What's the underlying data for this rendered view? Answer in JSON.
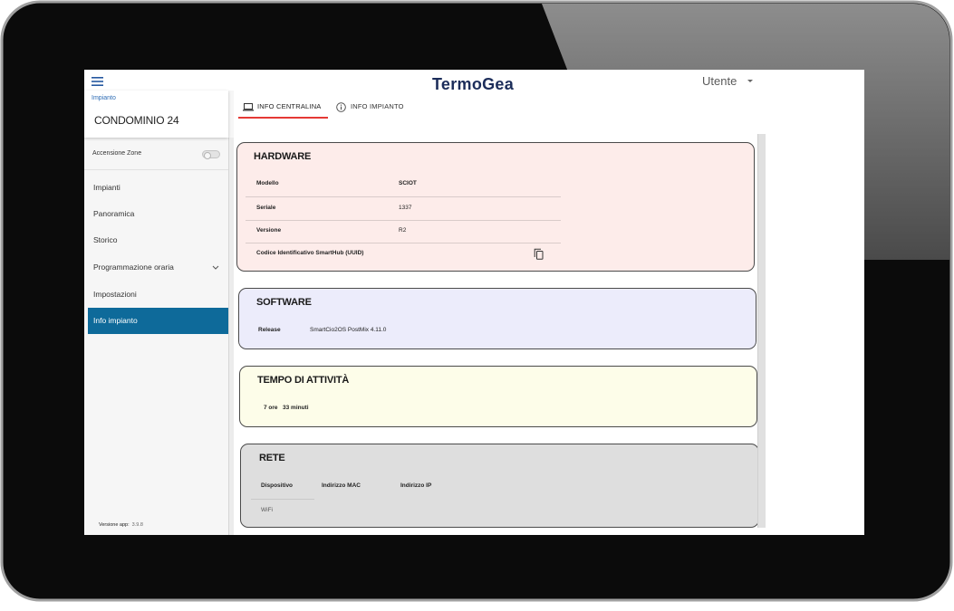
{
  "header": {
    "logo": "TermoGea",
    "user": "Utente"
  },
  "sidebar": {
    "plant_label": "Impianto",
    "plant_name": "CONDOMINIO 24",
    "zones_toggle": {
      "label": "Accensione Zone",
      "on": false
    },
    "items": [
      {
        "label": "Impianti",
        "selected": false
      },
      {
        "label": "Panoramica",
        "selected": false
      },
      {
        "label": "Storico",
        "selected": false
      },
      {
        "label": "Programmazione oraria",
        "selected": false,
        "expandable": true
      },
      {
        "label": "Impostazioni",
        "selected": false
      },
      {
        "label": "Info impianto",
        "selected": true
      }
    ],
    "app_version_label": "Versione app:",
    "app_version": "3.9.8"
  },
  "tabs": [
    {
      "label": "INFO CENTRALINA",
      "icon": "laptop-icon",
      "active": true
    },
    {
      "label": "INFO IMPIANTO",
      "icon": "info-icon",
      "active": false
    }
  ],
  "hardware": {
    "title": "HARDWARE",
    "rows": [
      {
        "label": "Modello",
        "value": "SCIOT"
      },
      {
        "label": "Seriale",
        "value": "1337"
      },
      {
        "label": "Versione",
        "value": "R2"
      },
      {
        "label": "Codice Identificativo SmartHub (UUID)",
        "action_icon": "copy-icon"
      }
    ]
  },
  "software": {
    "title": "SOFTWARE",
    "release_label": "Release",
    "release_value": "SmartCio2OS PostMix 4.11.0"
  },
  "uptime": {
    "title": "TEMPO DI ATTIVITÀ",
    "hours": "7 ore",
    "minutes": "33 minuti"
  },
  "network": {
    "title": "RETE",
    "columns": [
      "Dispositivo",
      "Indirizzo MAC",
      "Indirizzo IP"
    ],
    "rows": [
      {
        "device": "WiFi"
      }
    ]
  },
  "colors": {
    "accent_selected": "#0e6a9a",
    "tab_underline": "#e53935",
    "logo": "#1c2d5a",
    "hardware_card": "#fdecea",
    "software_card": "#ececfb",
    "uptime_card": "#fdfde9",
    "network_card": "#dedede",
    "bezel": "#0b0b0b"
  }
}
